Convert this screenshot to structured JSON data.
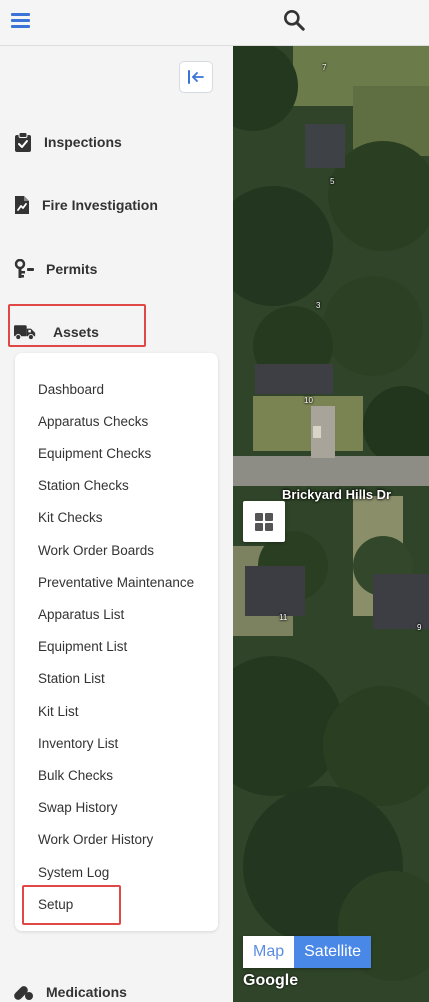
{
  "icons": {
    "menu": "hamburger-menu-icon",
    "search": "search-icon",
    "collapse": "collapse-left-icon",
    "inspections": "clipboard-check-icon",
    "fire": "file-chart-icon",
    "permits": "key-icon",
    "assets": "truck-icon",
    "medications": "pills-icon",
    "layers": "grid-icon"
  },
  "colors": {
    "accent": "#3b73d6",
    "highlight": "#e04848",
    "satellite_active": "#4a88e8"
  },
  "sidebar": {
    "items": [
      {
        "label": "Inspections"
      },
      {
        "label": "Fire Investigation"
      },
      {
        "label": "Permits"
      },
      {
        "label": "Assets"
      },
      {
        "label": "Medications"
      }
    ],
    "assets_submenu": [
      "Dashboard",
      "Apparatus Checks",
      "Equipment Checks",
      "Station Checks",
      "Kit Checks",
      "Work Order Boards",
      "Preventative Maintenance",
      "Apparatus List",
      "Equipment List",
      "Station List",
      "Kit List",
      "Inventory List",
      "Bulk Checks",
      "Swap History",
      "Work Order History",
      "System Log",
      "Setup"
    ]
  },
  "map": {
    "street_label": "Brickyard Hills Dr",
    "house_numbers": [
      "7",
      "5",
      "3",
      "10",
      "11",
      "9"
    ],
    "map_type_options": [
      "Map",
      "Satellite"
    ],
    "selected_map_type": "Satellite",
    "attribution": "Google"
  }
}
